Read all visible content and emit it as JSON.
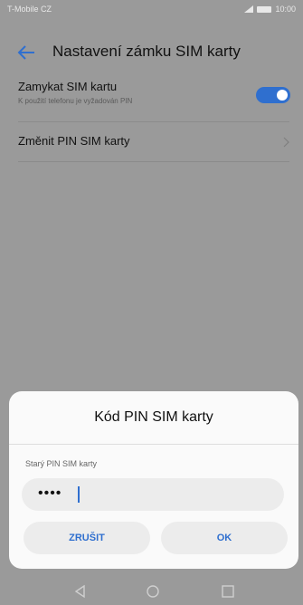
{
  "status_bar": {
    "carrier": "T-Mobile CZ",
    "time": "10:00"
  },
  "app_bar": {
    "title": "Nastavení zámku SIM karty"
  },
  "settings": {
    "lock_sim": {
      "title": "Zamykat SIM kartu",
      "subtitle": "K použití telefonu je vyžadován PIN",
      "enabled": true
    },
    "change_pin": {
      "title": "Změnit PIN SIM karty"
    }
  },
  "dialog": {
    "title": "Kód PIN SIM karty",
    "label": "Starý PIN SIM karty",
    "pin_value": "••••",
    "cancel_label": "ZRUŠIT",
    "ok_label": "OK"
  },
  "colors": {
    "accent": "#2f6fcf",
    "dim_background": "#9a9a9a",
    "dialog_background": "#fafafa"
  },
  "icons": {
    "back": "arrow-left-icon",
    "chevron": "chevron-right-icon",
    "nav": [
      "back-triangle-icon",
      "home-circle-icon",
      "recent-square-icon"
    ]
  }
}
